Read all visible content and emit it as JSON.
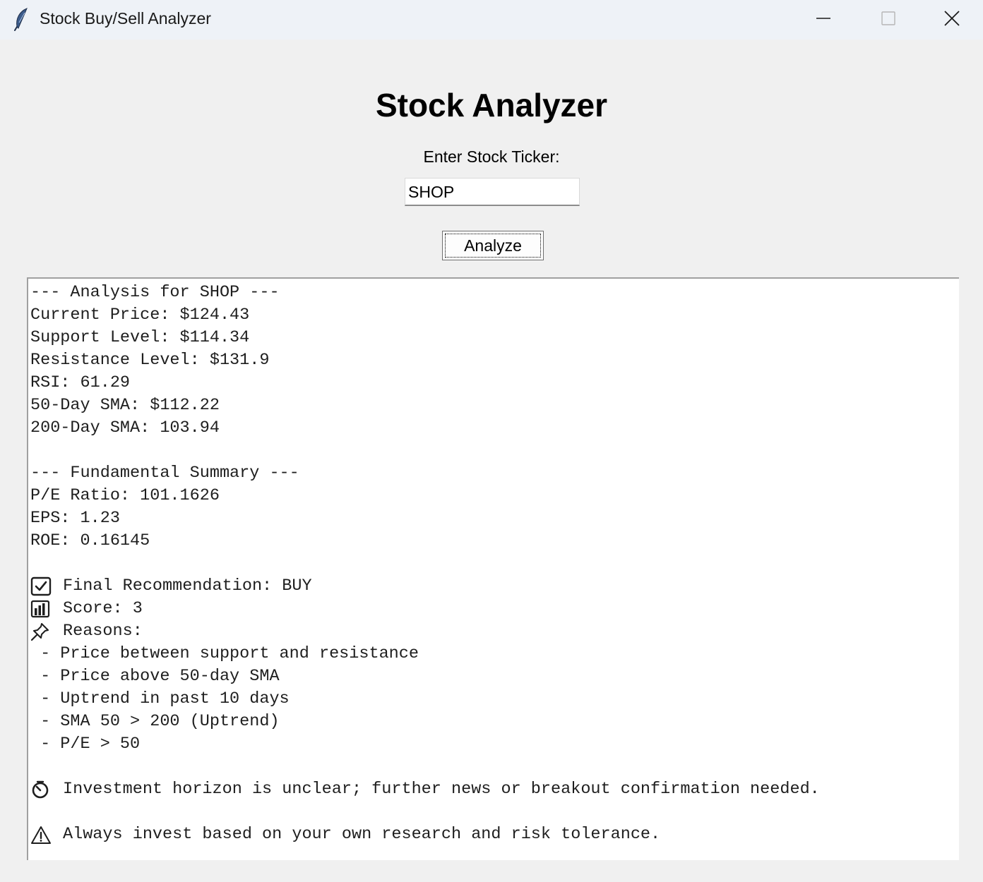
{
  "window": {
    "title": "Stock Buy/Sell Analyzer"
  },
  "main": {
    "heading": "Stock Analyzer",
    "ticker_label": "Enter Stock Ticker:",
    "ticker_value": "SHOP",
    "analyze_label": "Analyze"
  },
  "output": {
    "analysis_header": "--- Analysis for SHOP ---",
    "current_price": "Current Price: $124.43",
    "support_level": "Support Level: $114.34",
    "resistance_level": "Resistance Level: $131.9",
    "rsi": "RSI: 61.29",
    "sma50": "50-Day SMA: $112.22",
    "sma200": "200-Day SMA: 103.94",
    "fundamental_header": "--- Fundamental Summary ---",
    "pe_ratio": "P/E Ratio: 101.1626",
    "eps": "EPS: 1.23",
    "roe": "ROE: 0.16145",
    "recommendation": "Final Recommendation: BUY",
    "score": "Score: 3",
    "reasons_label": "Reasons:",
    "reasons": [
      " - Price between support and resistance",
      " - Price above 50-day SMA",
      " - Uptrend in past 10 days",
      " - SMA 50 > 200 (Uptrend)",
      " - P/E > 50"
    ],
    "horizon": "Investment horizon is unclear; further news or breakout confirmation needed.",
    "disclaimer": "Always invest based on your own research and risk tolerance."
  },
  "icons": {
    "app": "feather-icon",
    "minimize": "minimize-icon",
    "maximize": "maximize-icon",
    "close": "close-icon",
    "recommendation": "check-box-icon",
    "score": "bar-chart-icon",
    "reasons": "pushpin-icon",
    "horizon": "stopwatch-icon",
    "disclaimer": "warning-icon"
  }
}
